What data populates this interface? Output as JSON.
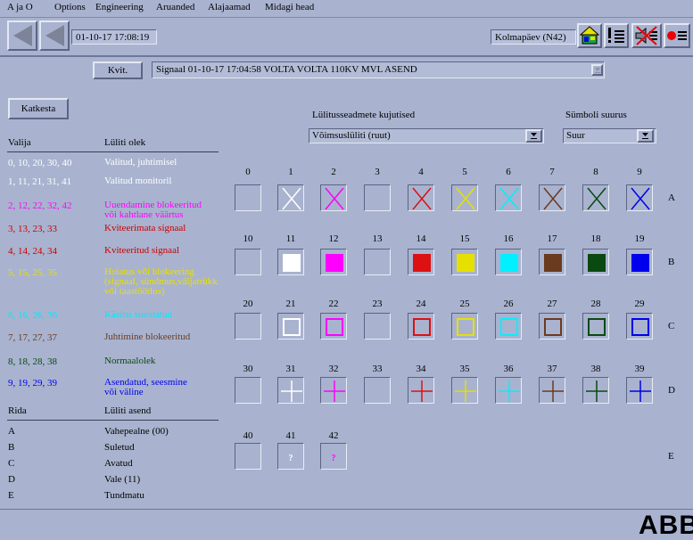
{
  "menu": [
    "A ja O",
    "Options",
    "Engineering",
    "Aruanded",
    "Alajaamad",
    "Midagi head"
  ],
  "toolbar": {
    "datetime": "01-10-17  17:08:19",
    "day_label": "Kolmapäev  (N42)"
  },
  "alarm": {
    "ack_label": "Kvit.",
    "signal_text": "Signaal 01-10-17 17:04:58  VOLTA  VOLTA     110KV  MVL ASEND"
  },
  "cancel_label": "Katkesta",
  "representations": {
    "label": "Lülitusseadmete kujutised",
    "value": "Võimsuslüliti (ruut)"
  },
  "symbol_size": {
    "label": "Sümboli suurus",
    "value": "Suur"
  },
  "legend": {
    "col1_header": "Valija",
    "col2_header": "Lüliti olek",
    "rows": [
      {
        "codes": "0, 10, 20, 30, 40",
        "state": "Valitud, juhtimisel",
        "color": "#ffffff"
      },
      {
        "codes": "1, 11, 21, 31, 41",
        "state": "Valitud monitoril",
        "color": "#ffffff"
      },
      {
        "codes": "2, 12, 22, 32, 42",
        "state": "Uuendamine blokeeritud\nvõi kahtlane väärtus",
        "color": "#ff00ff"
      },
      {
        "codes": "3, 13, 23, 33",
        "state": "Kviteerimata signaal",
        "color": "#cc0000"
      },
      {
        "codes": "4, 14, 24, 34",
        "state": "Kviteeritud signaal",
        "color": "#cc0000"
      },
      {
        "codes": "5, 15, 25, 35",
        "state": "Hoiatus või blokeering\n(signaal, sündmus,väljatrükk\nvõi taastöötlus)",
        "color": "#e8e000"
      },
      {
        "codes": "6, 16, 26, 36",
        "state": "Käsitsi sisestatud",
        "color": "#00e8ff"
      },
      {
        "codes": "7, 17, 27, 37",
        "state": "Juhtimine blokeeritud",
        "color": "#6b3b1e"
      },
      {
        "codes": "8, 18, 28, 38",
        "state": "Normaalolek",
        "color": "#0a4a10"
      },
      {
        "codes": "9, 19, 29, 39",
        "state": "Asendatud, seesmine\nvõi väline",
        "color": "#0000ee"
      }
    ],
    "pos_col1_header": "Rida",
    "pos_col2_header": "Lüliti asend",
    "positions": [
      {
        "row": "A",
        "state": "Vahepealne (00)"
      },
      {
        "row": "B",
        "state": "Suletud"
      },
      {
        "row": "C",
        "state": "Avatud"
      },
      {
        "row": "D",
        "state": "Vale (11)"
      },
      {
        "row": "E",
        "state": "Tundmatu"
      }
    ]
  },
  "grid": {
    "row_labels": [
      "A",
      "B",
      "C",
      "D",
      "E"
    ],
    "colors": [
      "none",
      "#ffffff",
      "#ff00ff",
      "none",
      "#dd1111",
      "#e6e000",
      "#00f0ff",
      "#6b3b1e",
      "#0a4a10",
      "#0000ee"
    ],
    "row_e_count": 3,
    "unknown_symbol": "?"
  },
  "logo": "ABB"
}
